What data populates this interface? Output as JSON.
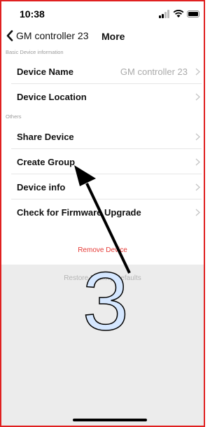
{
  "status_bar": {
    "time": "10:38"
  },
  "nav": {
    "back_label": "GM controller 23",
    "title": "More"
  },
  "sections": {
    "basic": "Basic Device information",
    "others": "Others"
  },
  "rows": [
    {
      "label": "Device Name",
      "value": "GM controller 23"
    },
    {
      "label": "Device Location",
      "value": ""
    },
    {
      "label": "Share Device",
      "value": ""
    },
    {
      "label": "Create Group",
      "value": ""
    },
    {
      "label": "Device info",
      "value": ""
    },
    {
      "label": "Check for Firmware Upgrade",
      "value": ""
    }
  ],
  "actions": {
    "remove": "Remove Device",
    "restore": "Restore Factory Defaults"
  },
  "annotation": {
    "number": "3"
  },
  "colors": {
    "frame": "#e02020",
    "remove_text": "#e53935",
    "restore_text": "#b5b5b5",
    "number_fill": "#d5e7ff"
  },
  "icons": [
    "chevron-left-icon",
    "chevron-right-icon",
    "signal-icon",
    "wifi-icon",
    "battery-icon",
    "arrow-annotation"
  ]
}
